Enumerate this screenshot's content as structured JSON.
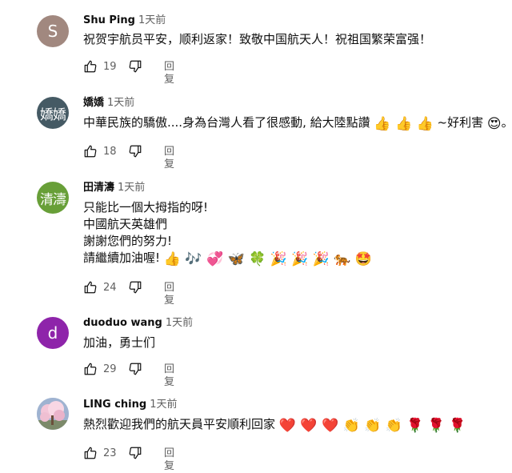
{
  "reply_label": "回复",
  "comments": [
    {
      "avatar_text": "S",
      "avatar_color": "#a1887f",
      "author": "Shu Ping",
      "time": "1天前",
      "lines": [
        {
          "text": "祝贺宇航员平安，顺利返家！致敬中国航天人！祝祖国繁荣富强！"
        }
      ],
      "likes": "19"
    },
    {
      "avatar_text": "嬌嬌",
      "avatar_color": "#455a64",
      "author": "嬌嬌",
      "time": "1天前",
      "lines": [
        {
          "text": "中華民族的驕傲....身為台灣人看了很感動, 給大陸點讚",
          "emoji": "👍 👍 👍",
          "text2": "~好利害",
          "emoji2": "😍",
          "text3": "。"
        }
      ],
      "likes": "18"
    },
    {
      "avatar_text": "清濤",
      "avatar_color": "#689f38",
      "author": "田清濤",
      "time": "1天前",
      "lines": [
        {
          "text": "只能比一個大拇指的呀!"
        },
        {
          "text": "中國航天英雄們"
        },
        {
          "text": "謝謝您們的努力!"
        },
        {
          "text": "請繼續加油喔!",
          "emoji": "👍 🎶 💞 🦋 🍀 🎉 🎉 🎉 🐅 🤩"
        }
      ],
      "likes": "24"
    },
    {
      "avatar_text": "d",
      "avatar_color": "#8e24aa",
      "author": "duoduo wang",
      "time": "1天前",
      "lines": [
        {
          "text": "加油，勇士们"
        }
      ],
      "likes": "29"
    },
    {
      "avatar_text": "",
      "avatar_color": "#b8c4d8",
      "author": "LING ching",
      "time": "1天前",
      "lines": [
        {
          "text": "熱烈歡迎我們的航天員平安順利回家",
          "emoji": "❤️ ❤️ ❤️ 👏 👏 👏 🌹 🌹 🌹"
        }
      ],
      "likes": "23"
    }
  ]
}
